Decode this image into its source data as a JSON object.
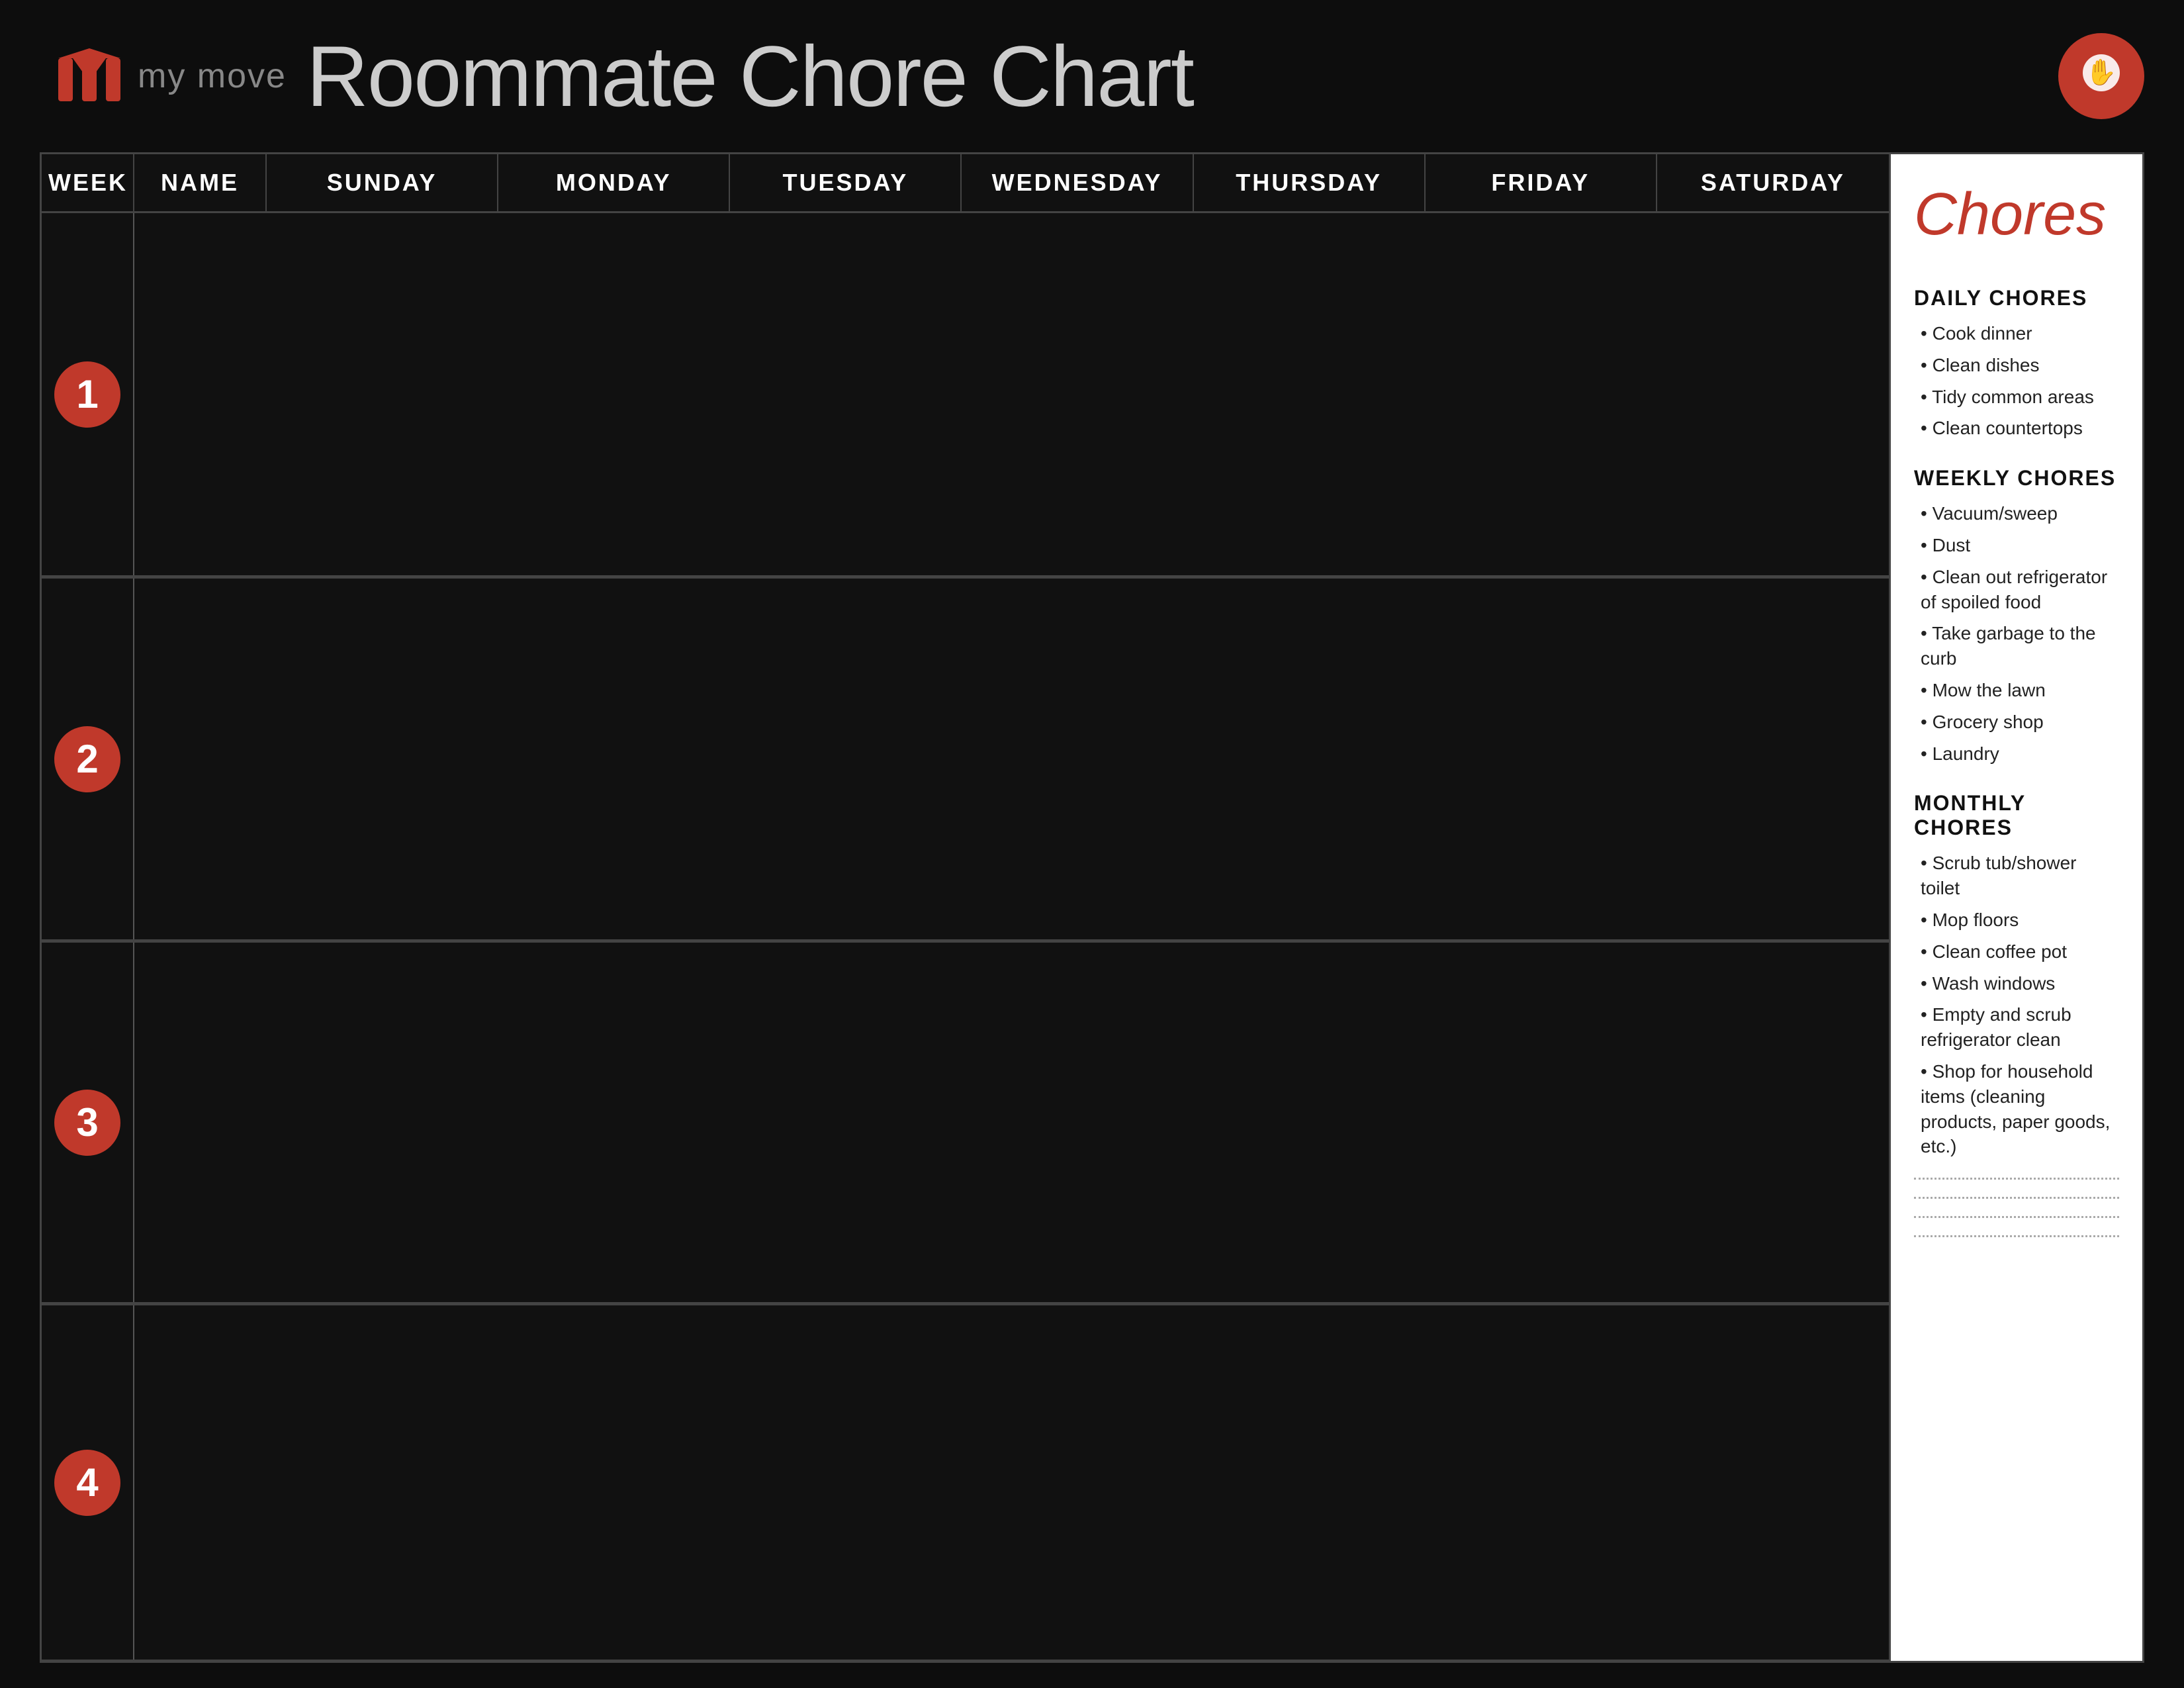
{
  "header": {
    "logo_text": "my move",
    "title": "Roommate Chore Chart"
  },
  "table": {
    "columns": [
      "WEEK",
      "NAME",
      "SUNDAY",
      "MONDAY",
      "TUESDAY",
      "WEDNESDAY",
      "THURSDAY",
      "FRIDAY",
      "SATURDAY"
    ],
    "weeks": [
      {
        "number": "1"
      },
      {
        "number": "2"
      },
      {
        "number": "3"
      },
      {
        "number": "4"
      }
    ]
  },
  "sidebar": {
    "title": "Chores",
    "daily_section": "DAILY CHORES",
    "daily_items": [
      "Cook dinner",
      "Clean dishes",
      "Tidy common areas",
      "Clean countertops"
    ],
    "weekly_section": "WEEKLY CHORES",
    "weekly_items": [
      "Vacuum/sweep",
      "Dust",
      "Clean out refrigerator of spoiled food",
      "Take garbage to the curb",
      "Mow the lawn",
      "Grocery shop",
      "Laundry"
    ],
    "monthly_section": "MONTHLY CHORES",
    "monthly_items": [
      "Scrub tub/shower toilet",
      "Mop floors",
      "Clean coffee pot",
      "Wash windows",
      "Empty and scrub refrigerator clean",
      "Shop for household items (cleaning products, paper goods, etc.)"
    ]
  }
}
